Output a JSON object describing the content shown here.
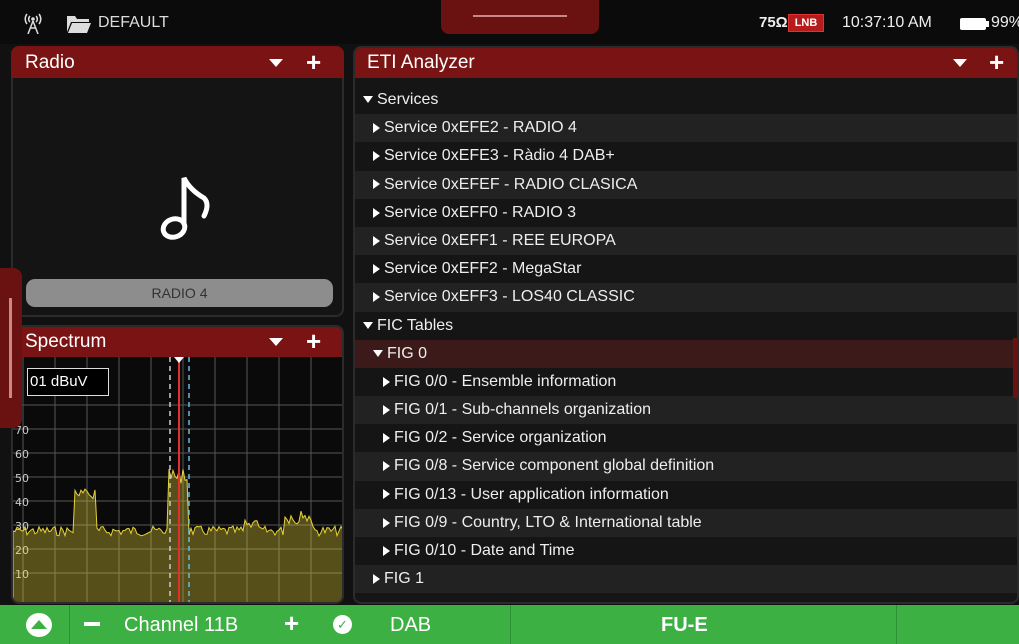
{
  "status_bar": {
    "profile_name": "DEFAULT",
    "impedance": "75Ω",
    "lnb_badge": "LNB",
    "time": "10:37:10 AM",
    "battery": "99%",
    "icons": [
      "antenna-icon",
      "folder-icon",
      "battery-icon"
    ]
  },
  "radio_panel": {
    "title": "Radio",
    "station_name": "RADIO 4",
    "icon": "music-note-icon"
  },
  "spectrum_panel": {
    "title": "Spectrum",
    "reference_level": "01 dBuV",
    "y_tick_labels": [
      "0",
      "70",
      "60",
      "50",
      "40",
      "30",
      "20",
      "10"
    ]
  },
  "eti_panel": {
    "title": "ETI Analyzer",
    "tree": [
      {
        "label": "Services",
        "level": 0,
        "expanded": true
      },
      {
        "label": "Service 0xEFE2 - RADIO 4",
        "level": 1,
        "expanded": false
      },
      {
        "label": "Service 0xEFE3 - Ràdio 4 DAB+",
        "level": 1,
        "expanded": false
      },
      {
        "label": "Service 0xEFEF - RADIO CLASICA",
        "level": 1,
        "expanded": false
      },
      {
        "label": "Service 0xEFF0 - RADIO 3",
        "level": 1,
        "expanded": false
      },
      {
        "label": "Service 0xEFF1 - REE EUROPA",
        "level": 1,
        "expanded": false
      },
      {
        "label": "Service 0xEFF2 - MegaStar",
        "level": 1,
        "expanded": false
      },
      {
        "label": "Service 0xEFF3 - LOS40 CLASSIC",
        "level": 1,
        "expanded": false
      },
      {
        "label": "FIC Tables",
        "level": 0,
        "expanded": true
      },
      {
        "label": "FIG 0",
        "level": 1,
        "expanded": true,
        "selected": true
      },
      {
        "label": "FIG 0/0 - Ensemble information",
        "level": 2,
        "expanded": false
      },
      {
        "label": "FIG 0/1 - Sub-channels organization",
        "level": 2,
        "expanded": false
      },
      {
        "label": "FIG 0/2 - Service organization",
        "level": 2,
        "expanded": false
      },
      {
        "label": "FIG 0/8 - Service component global definition",
        "level": 2,
        "expanded": false
      },
      {
        "label": "FIG 0/13 - User application information",
        "level": 2,
        "expanded": false
      },
      {
        "label": "FIG 0/9 - Country, LTO & International table",
        "level": 2,
        "expanded": false
      },
      {
        "label": "FIG 0/10 - Date and Time",
        "level": 2,
        "expanded": false
      },
      {
        "label": "FIG 1",
        "level": 1,
        "expanded": false
      }
    ]
  },
  "bottom_bar": {
    "channel_label": "Channel 11B",
    "standard": "DAB",
    "region": "FU-E"
  },
  "colors": {
    "panel_header": "#7a1414",
    "bottom_bar": "#3cb043",
    "spectrum_trace": "#e6d23a",
    "marker": "#e03030"
  }
}
